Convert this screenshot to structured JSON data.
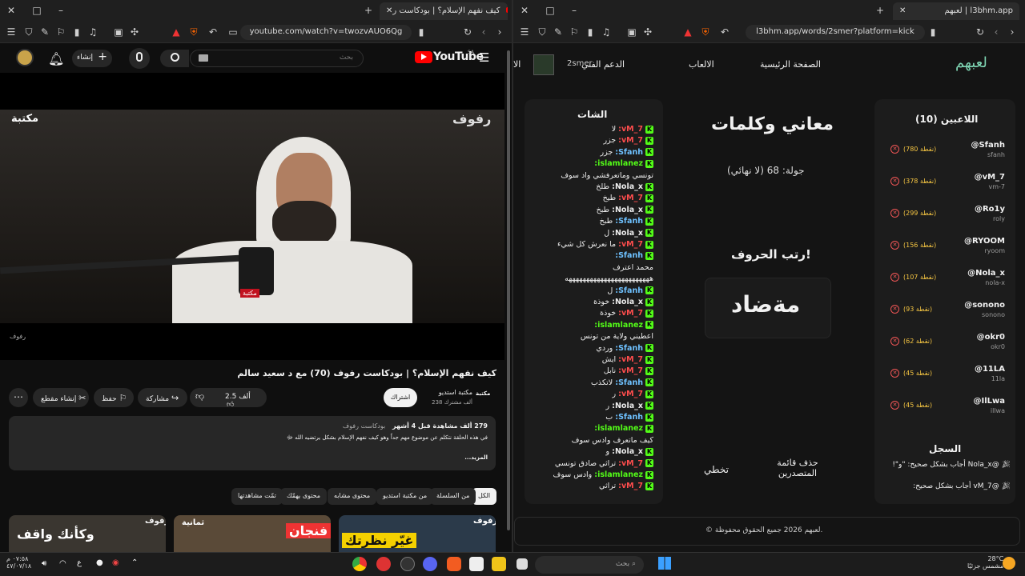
{
  "left_window": {
    "tab_title": "كيف نفهم الإسلام؟ | بودكاست ر",
    "url": "youtube.com/watch?v=twozvAUO6Qg"
  },
  "right_window": {
    "tab_title": "لعبهم | l3bhm.app",
    "url": "l3bhm.app/words/2smer?platform=kick"
  },
  "youtube": {
    "logo": "YouTube",
    "logo_country": "SA",
    "search_placeholder": "بحث",
    "create_label": "إنشاء",
    "video_watermark_left": "مكتبة",
    "video_watermark_right": "رفوف",
    "video_overlay_small": "رفوف",
    "mic_label": "مكتبة",
    "video_title": "كيف نفهم الإسلام؟ | بودكاست رفوف (70) مع د سعيد سالم",
    "channel_name": "مكتبة استديو",
    "channel_logo": "مكتبة",
    "subscribers": "238 ألف مشترك",
    "subscribe_label": "اشتراك",
    "likes": "2.5 ألف",
    "share_label": "مشاركة",
    "save_label": "حفظ",
    "clip_label": "إنشاء مقطع",
    "views_line": "279 ألف مشاهدة  قبل 4 أشهر",
    "playlist_tag": "بودكاست رفوف",
    "description": "في هذه الحلقة نتكلم عن موضوع مهم جداً وهو كيف نفهم الإسلام بشكل يرتضيه الله ﷻ",
    "more_label": "...المزيد",
    "chips": [
      "الكل",
      "من السلسلة",
      "من مكتبة استديو",
      "محتوى مشابه",
      "محتوى يهمّك",
      "تمّت مشاهدتها"
    ],
    "thumbnails": [
      {
        "tag": "رفوف",
        "caption": "وكأنك واقف"
      },
      {
        "tag": "ثمانية",
        "caption": "فنجان"
      },
      {
        "tag": "رفوف",
        "caption": "غيّر نظرتك"
      }
    ]
  },
  "l3bhm": {
    "logo": "لعبهم",
    "nav": [
      "الصفحة الرئيسية",
      "الالعاب",
      "الدعم الفني",
      "الا"
    ],
    "user_tag": "2smer",
    "players_title": "اللاعبين (10)",
    "players": [
      {
        "handle": "@Sfanh",
        "sub": "sfanh",
        "points": "(780 نقطة)"
      },
      {
        "handle": "@vM_7",
        "sub": "vm-7",
        "points": "(378 نقطة)"
      },
      {
        "handle": "@Ro1y",
        "sub": "roly",
        "points": "(299 نقطة)"
      },
      {
        "handle": "@RYOOM",
        "sub": "ryoom",
        "points": "(156 نقطة)"
      },
      {
        "handle": "@Nola_x",
        "sub": "nola-x",
        "points": "(107 نقطة)"
      },
      {
        "handle": "@sonono",
        "sub": "sonono",
        "points": "(93 نقطة)"
      },
      {
        "handle": "@okr0",
        "sub": "okr0",
        "points": "(62 نقطة)"
      },
      {
        "handle": "@11LA",
        "sub": "11la",
        "points": "(45 نقطة)"
      },
      {
        "handle": "@IlLwa",
        "sub": "illwa",
        "points": "(45 نقطة)"
      }
    ],
    "game_title": "معاني وكلمات",
    "round": "جولة: 68 (لا نهائي)",
    "instruction": "رتب الحروف!",
    "scrambled": "مةضاد",
    "remove_board": "حذف قائمة المتصدرين",
    "skip": "تخطي",
    "log_title": "السجل",
    "log": [
      "@Nola_x أجاب بشكل صحيح: \"و\"!",
      "@vM_7 أجاب بشكل صحيح:"
    ],
    "chat_title": "الشات",
    "chat": [
      {
        "user": "vM_7:",
        "msg": "لا",
        "color": "#ff4d4d"
      },
      {
        "user": "vM_7:",
        "msg": "جزر",
        "color": "#ff4d4d"
      },
      {
        "user": "Sfanh:",
        "msg": "جزر",
        "color": "#6ec1ff"
      },
      {
        "user": "islamlanez:",
        "msg": "",
        "color": "#53fc18"
      },
      {
        "user": "",
        "msg": "تونسي وماتعرفشي واد سوف",
        "color": "#eee"
      },
      {
        "user": "Nola_x:",
        "msg": "طلخ",
        "color": "#eee"
      },
      {
        "user": "vM_7:",
        "msg": "طيخ",
        "color": "#ff4d4d"
      },
      {
        "user": "Nola_x:",
        "msg": "طبخ",
        "color": "#eee"
      },
      {
        "user": "Sfanh:",
        "msg": "طبخ",
        "color": "#6ec1ff"
      },
      {
        "user": "Nola_x:",
        "msg": "ل",
        "color": "#eee"
      },
      {
        "user": "vM_7:",
        "msg": "ما نعرش كل شيء",
        "color": "#ff4d4d"
      },
      {
        "user": "Sfanh:",
        "msg": "",
        "color": "#6ec1ff"
      },
      {
        "user": "",
        "msg": "محمد اعترف",
        "color": "#eee"
      },
      {
        "user": "",
        "msg": "ههههههههههههههههههههههههه",
        "color": "#eee"
      },
      {
        "user": "Sfanh:",
        "msg": "ل",
        "color": "#6ec1ff"
      },
      {
        "user": "Nola_x:",
        "msg": "خوذة",
        "color": "#eee"
      },
      {
        "user": "vM_7:",
        "msg": "خوذة",
        "color": "#ff4d4d"
      },
      {
        "user": "islamlanez:",
        "msg": "",
        "color": "#53fc18"
      },
      {
        "user": "",
        "msg": "اعطيني ولاية من تونس",
        "color": "#eee"
      },
      {
        "user": "Sfanh:",
        "msg": "وردي",
        "color": "#6ec1ff"
      },
      {
        "user": "vM_7:",
        "msg": "ايش",
        "color": "#ff4d4d"
      },
      {
        "user": "vM_7:",
        "msg": "نابل",
        "color": "#ff4d4d"
      },
      {
        "user": "Sfanh:",
        "msg": "لاتكذب",
        "color": "#6ec1ff"
      },
      {
        "user": "vM_7:",
        "msg": "ر",
        "color": "#ff4d4d"
      },
      {
        "user": "Nola_x:",
        "msg": "ر",
        "color": "#eee"
      },
      {
        "user": "Sfanh:",
        "msg": "ب",
        "color": "#6ec1ff"
      },
      {
        "user": "islamlanez:",
        "msg": "",
        "color": "#53fc18"
      },
      {
        "user": "",
        "msg": "كيف ماتعرف وادس سوف",
        "color": "#eee"
      },
      {
        "user": "Nola_x:",
        "msg": "و",
        "color": "#eee"
      },
      {
        "user": "vM_7:",
        "msg": "تراثي صادق تونسي",
        "color": "#ff4d4d"
      },
      {
        "user": "islamlanez:",
        "msg": "وادس سوف",
        "color": "#53fc18"
      },
      {
        "user": "vM_7:",
        "msg": "تراثي",
        "color": "#ff4d4d"
      }
    ],
    "footer": "© لعبهم 2026 جميع الحقوق محفوظة."
  },
  "taskbar": {
    "search_placeholder": "بحث",
    "weather_temp": "28°C",
    "weather_desc": "مشمس جزئيًا",
    "time": "٠٧:٥٨ م",
    "date": "٤٧/٠٧/١٨",
    "lang": "ع"
  }
}
